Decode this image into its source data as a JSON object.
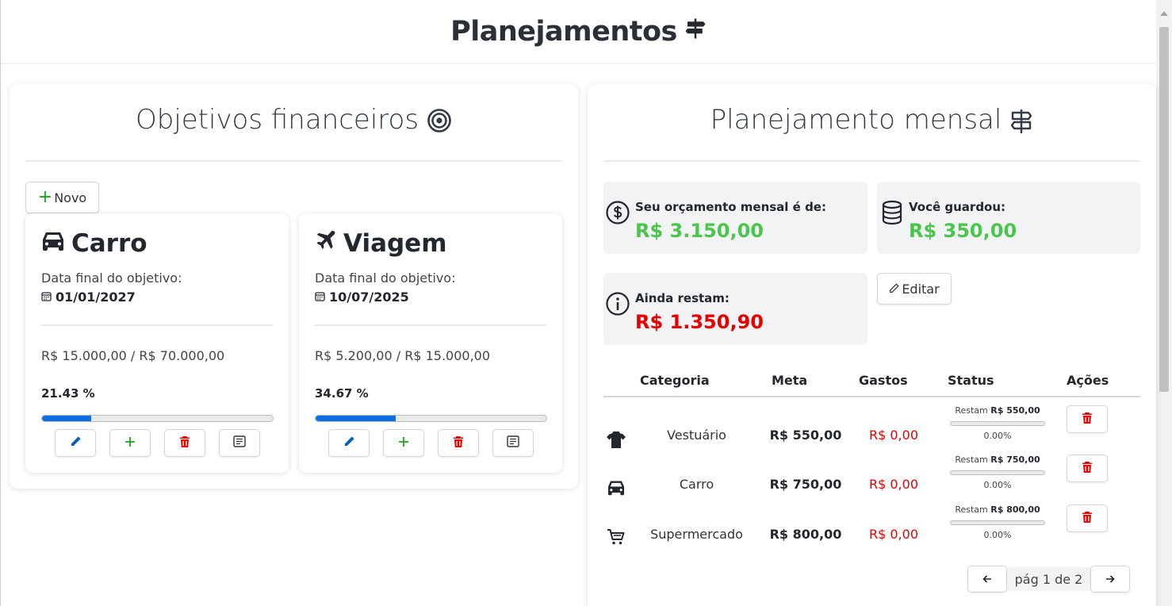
{
  "page": {
    "title": "Planejamentos"
  },
  "goals_panel": {
    "title": "Objetivos financeiros",
    "new_button_label": "Novo",
    "goals": [
      {
        "name": "Carro",
        "icon": "car-icon",
        "date_label": "Data final do objetivo:",
        "date": "01/01/2027",
        "amount_text": "R$ 15.000,00 / R$ 70.000,00",
        "percent_text": "21.43 %",
        "progress": 0.2143
      },
      {
        "name": "Viagem",
        "icon": "plane-icon",
        "date_label": "Data final do objetivo:",
        "date": "10/07/2025",
        "amount_text": "R$ 5.200,00 / R$ 15.000,00",
        "percent_text": "34.67 %",
        "progress": 0.3467
      }
    ]
  },
  "monthly_panel": {
    "title": "Planejamento mensal",
    "budget": {
      "label": "Seu orçamento mensal é de:",
      "value": "R$ 3.150,00"
    },
    "saved": {
      "label": "Você guardou:",
      "value": "R$ 350,00"
    },
    "remaining": {
      "label": "Ainda restam:",
      "value": "R$ 1.350,90"
    },
    "edit_button_label": "Editar",
    "table": {
      "headers": [
        "Categoria",
        "Meta",
        "Gastos",
        "Status",
        "Ações"
      ],
      "rows": [
        {
          "icon": "shirt-icon",
          "category": "Vestuário",
          "meta": "R$ 550,00",
          "gastos": "R$ 0,00",
          "restam_label": "Restam",
          "restam_value": "R$ 550,00",
          "percent_text": "0.00%",
          "progress": 0
        },
        {
          "icon": "car-icon",
          "category": "Carro",
          "meta": "R$ 750,00",
          "gastos": "R$ 0,00",
          "restam_label": "Restam",
          "restam_value": "R$ 750,00",
          "percent_text": "0.00%",
          "progress": 0
        },
        {
          "icon": "cart-icon",
          "category": "Supermercado",
          "meta": "R$ 800,00",
          "gastos": "R$ 0,00",
          "restam_label": "Restam",
          "restam_value": "R$ 800,00",
          "percent_text": "0.00%",
          "progress": 0
        }
      ]
    },
    "pagination": {
      "text": "pág 1 de 2"
    }
  },
  "colors": {
    "positive": "#4bc54b",
    "negative": "#e60000",
    "progress": "#0b6fe0",
    "add": "#1aa51a",
    "edit": "#0b5fb8",
    "delete": "#e60000"
  }
}
